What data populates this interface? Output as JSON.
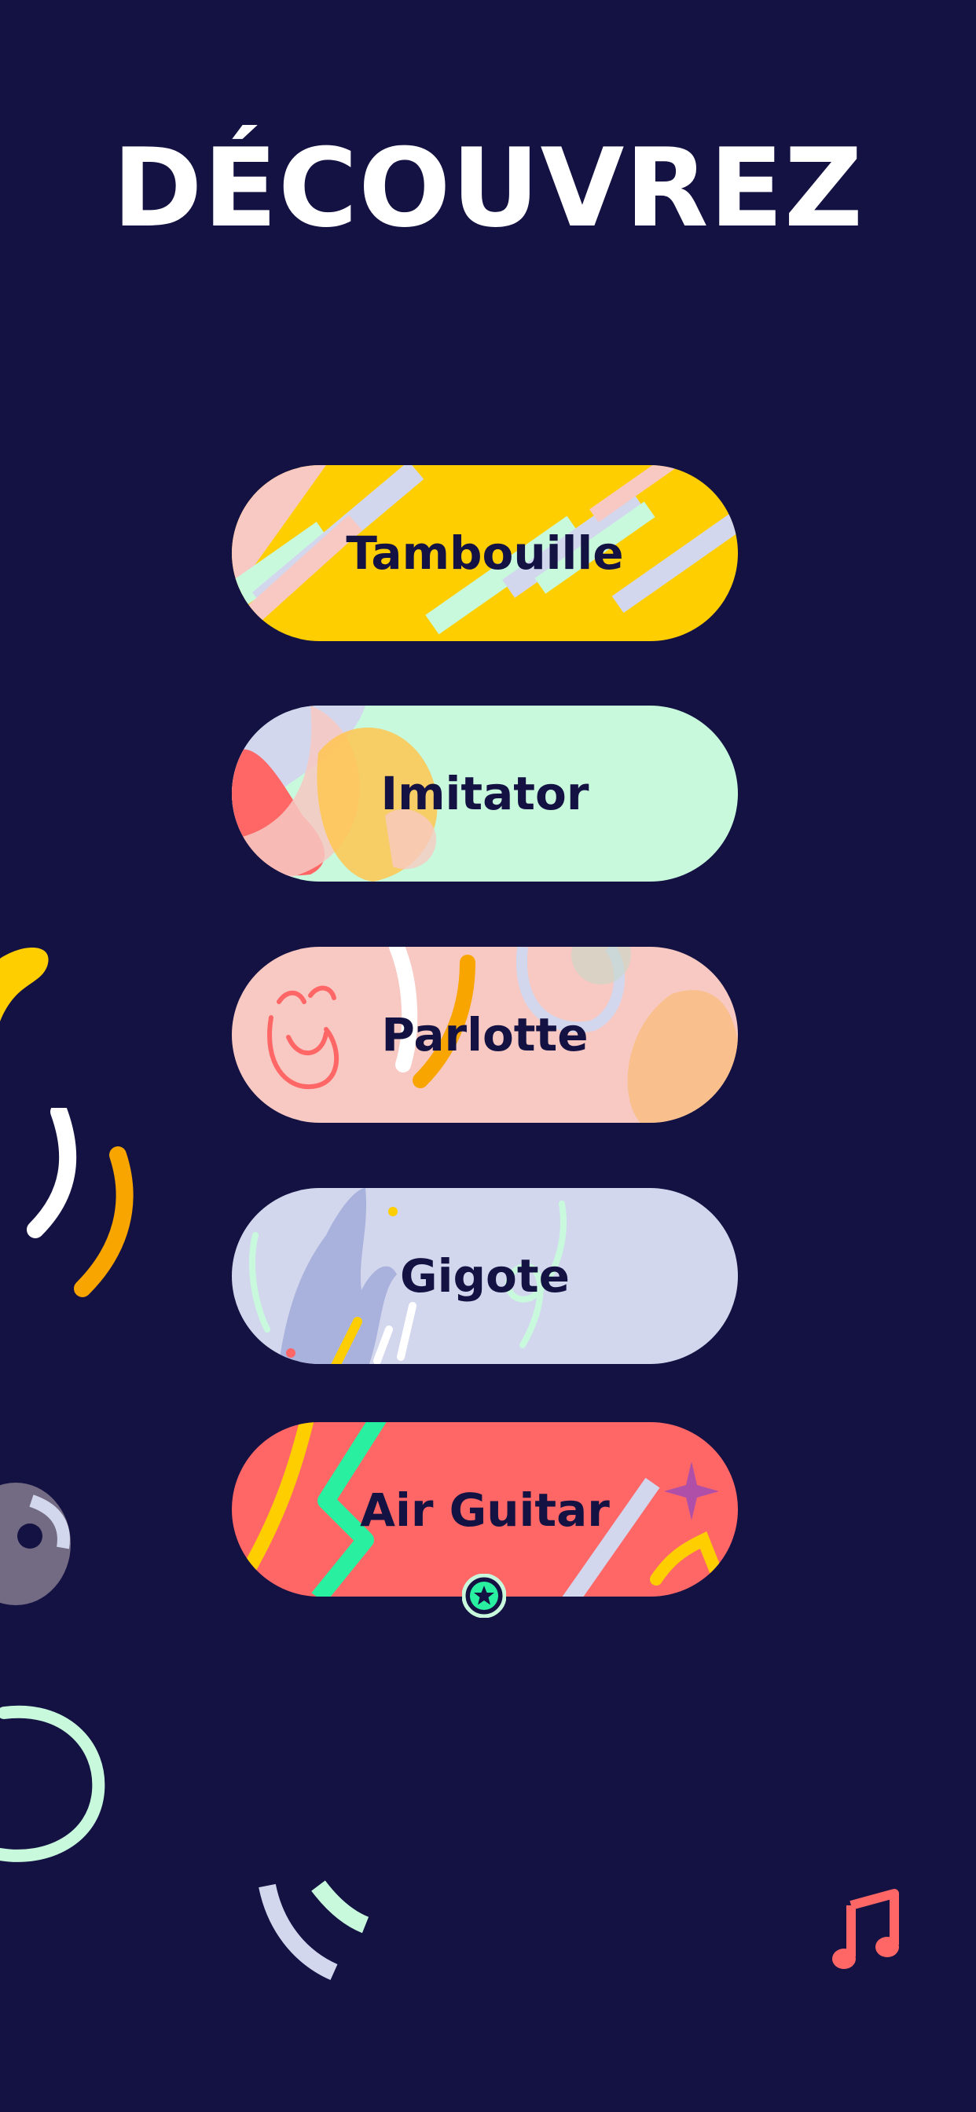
{
  "page": {
    "title": "DÉCOUVREZ"
  },
  "games": [
    {
      "label": "Tambouille",
      "color": "#FFCE00"
    },
    {
      "label": "Imitator",
      "color": "#C8F9DD"
    },
    {
      "label": "Parlotte",
      "color": "#F7C9C2"
    },
    {
      "label": "Gigote",
      "color": "#D3D7EE"
    },
    {
      "label": "Air Guitar",
      "color": "#FF6767"
    }
  ],
  "colors": {
    "background": "#141243",
    "label_text": "#141243",
    "title_text": "#FFFFFF"
  },
  "icons": {
    "badge": "star-badge-icon",
    "music": "music-note-icon"
  }
}
